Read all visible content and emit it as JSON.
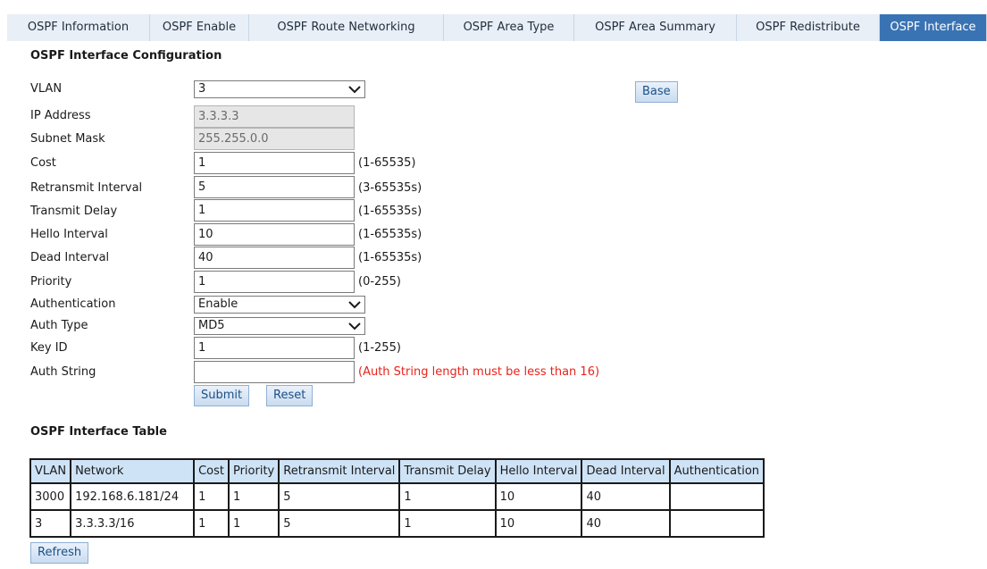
{
  "tabs": [
    {
      "label": "OSPF Information"
    },
    {
      "label": "OSPF Enable"
    },
    {
      "label": "OSPF Route Networking"
    },
    {
      "label": "OSPF Area Type"
    },
    {
      "label": "OSPF Area Summary"
    },
    {
      "label": "OSPF Redistribute"
    },
    {
      "label": "OSPF Interface"
    }
  ],
  "active_tab": "OSPF Interface",
  "config": {
    "title": "OSPF Interface Configuration",
    "vlan": {
      "label": "VLAN",
      "value": "3"
    },
    "base_button": "Base",
    "ip_address": {
      "label": "IP Address",
      "value": "3.3.3.3"
    },
    "subnet_mask": {
      "label": "Subnet Mask",
      "value": "255.255.0.0"
    },
    "cost": {
      "label": "Cost",
      "value": "1",
      "hint": "(1-65535)"
    },
    "retransmit_interval": {
      "label": "Retransmit Interval",
      "value": "5",
      "hint": "(3-65535s)"
    },
    "transmit_delay": {
      "label": "Transmit Delay",
      "value": "1",
      "hint": "(1-65535s)"
    },
    "hello_interval": {
      "label": "Hello Interval",
      "value": "10",
      "hint": "(1-65535s)"
    },
    "dead_interval": {
      "label": "Dead Interval",
      "value": "40",
      "hint": "(1-65535s)"
    },
    "priority": {
      "label": "Priority",
      "value": "1",
      "hint": "(0-255)"
    },
    "authentication": {
      "label": "Authentication",
      "value": "Enable"
    },
    "auth_type": {
      "label": "Auth Type",
      "value": "MD5"
    },
    "key_id": {
      "label": "Key ID",
      "value": "1",
      "hint": "(1-255)"
    },
    "auth_string": {
      "label": "Auth String",
      "value": "",
      "hint": "(Auth String length must be less than 16)"
    },
    "submit_button": "Submit",
    "reset_button": "Reset"
  },
  "table": {
    "title": "OSPF Interface Table",
    "headers": [
      "VLAN",
      "Network",
      "Cost",
      "Priority",
      "Retransmit Interval",
      "Transmit Delay",
      "Hello Interval",
      "Dead Interval",
      "Authentication"
    ],
    "rows": [
      [
        "3000",
        "192.168.6.181/24",
        "1",
        "1",
        "5",
        "1",
        "10",
        "40",
        ""
      ],
      [
        "3",
        "3.3.3.3/16",
        "1",
        "1",
        "5",
        "1",
        "10",
        "40",
        ""
      ]
    ],
    "refresh_button": "Refresh"
  },
  "colors": {
    "active_tab": "#3a73b3",
    "tab_bar": "#e9eff6",
    "warning": "#e8231b",
    "table_header": "#cfe3f7"
  }
}
